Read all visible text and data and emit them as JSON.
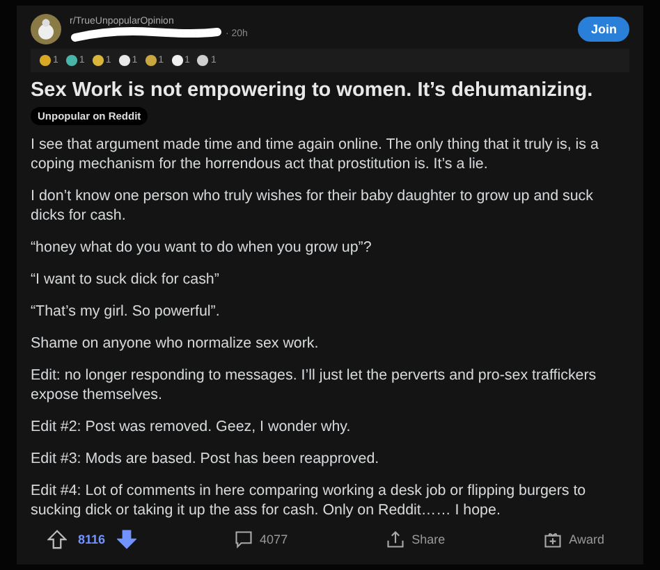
{
  "post": {
    "subreddit": "r/TrueUnpopularOpinion",
    "time": "· 20h",
    "username_redacted": true,
    "join": "Join",
    "awards": [
      {
        "count": "1",
        "color": "#d9a923"
      },
      {
        "count": "1",
        "color": "#48b5a8"
      },
      {
        "count": "1",
        "color": "#d9b53a"
      },
      {
        "count": "1",
        "color": "#e8e8e8"
      },
      {
        "count": "1",
        "color": "#c9a640"
      },
      {
        "count": "1",
        "color": "#f0f0f0"
      },
      {
        "count": "1",
        "color": "#cfcfcf"
      }
    ],
    "title": "Sex Work is not empowering to women. It’s dehumanizing.",
    "flair": "Unpopular on Reddit",
    "paragraphs": [
      "I see that argument made time and time again online. The only thing that it truly is, is a coping mechanism for the horrendous act that prostitution is. It’s a lie.",
      "I don’t know one person who truly wishes for their baby daughter to grow up and suck dicks for cash.",
      "“honey what do you want to do when you grow up”?",
      "“I want to suck dick for cash”",
      "“That’s my girl. So powerful”.",
      "Shame on anyone who normalize sex work.",
      "Edit: no longer responding to messages. I’ll just let the perverts and pro-sex traffickers expose themselves.",
      "Edit #2: Post was removed. Geez, I wonder why.",
      "Edit #3: Mods are based. Post has been reapproved.",
      "Edit #4: Lot of comments in here comparing working a desk job or flipping burgers to sucking dick or taking it up the ass for cash. Only on Reddit…… I hope."
    ],
    "score": "8116",
    "upvoted": false,
    "downvoted": true,
    "comments": "4077",
    "share": "Share",
    "award": "Award"
  }
}
